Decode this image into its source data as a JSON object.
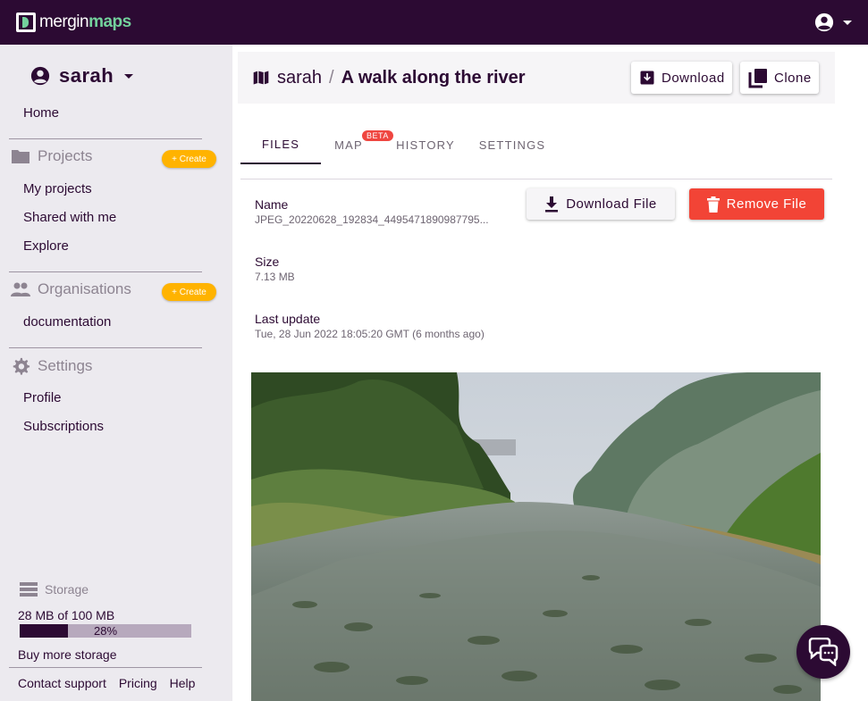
{
  "app": {
    "logo_text_light": "mergin",
    "logo_text_bold": "maps"
  },
  "topbar": {
    "account_icon": "account-circle-icon"
  },
  "sidebar": {
    "user": "sarah",
    "home": "Home",
    "projects": {
      "label": "Projects",
      "create": "+ Create",
      "items": [
        "My projects",
        "Shared with me",
        "Explore"
      ]
    },
    "organisations": {
      "label": "Organisations",
      "create": "+ Create",
      "items": [
        "documentation"
      ]
    },
    "settings": {
      "label": "Settings",
      "items": [
        "Profile",
        "Subscriptions"
      ]
    },
    "storage": {
      "label": "Storage",
      "usage_text": "28 MB of 100 MB",
      "percent_label": "28%",
      "used_fraction": 0.28,
      "buy_more": "Buy more storage"
    },
    "footer": [
      "Contact support",
      "Pricing",
      "Help"
    ]
  },
  "header": {
    "namespace": "sarah",
    "separator": "/",
    "project": "A walk along the river",
    "download_label": "Download",
    "clone_label": "Clone"
  },
  "tabs": [
    {
      "label": "FILES",
      "active": true
    },
    {
      "label": "MAP",
      "badge": "BETA"
    },
    {
      "label": "HISTORY"
    },
    {
      "label": "SETTINGS"
    }
  ],
  "file": {
    "name_label": "Name",
    "name_value": "JPEG_20220628_192834_4495471890987795...",
    "size_label": "Size",
    "size_value": "7.13 MB",
    "updated_label": "Last update",
    "updated_value": "Tue, 28 Jun 2022 18:05:20 GMT (6 months ago)",
    "download_file_label": "Download File",
    "remove_file_label": "Remove File"
  },
  "colors": {
    "brand": "#2c0a33",
    "accent_green": "#73d19c",
    "create_yellow": "#ffb300",
    "danger": "#f24436"
  }
}
